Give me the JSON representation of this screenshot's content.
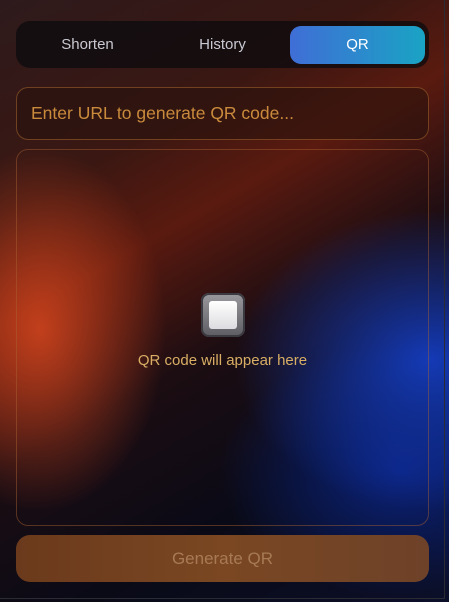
{
  "tabs": [
    {
      "label": "Shorten",
      "active": false
    },
    {
      "label": "History",
      "active": false
    },
    {
      "label": "QR",
      "active": true
    }
  ],
  "url_input": {
    "value": "",
    "placeholder": "Enter URL to generate QR code..."
  },
  "preview": {
    "icon": "qr-placeholder-square-icon",
    "text": "QR code will appear here"
  },
  "generate_button": {
    "label": "Generate QR",
    "disabled": true
  },
  "colors": {
    "active_tab_start": "#3f6ed6",
    "active_tab_end": "#1aa3c4",
    "accent_text": "#d9ae64",
    "button_bg": "#7a4722"
  }
}
